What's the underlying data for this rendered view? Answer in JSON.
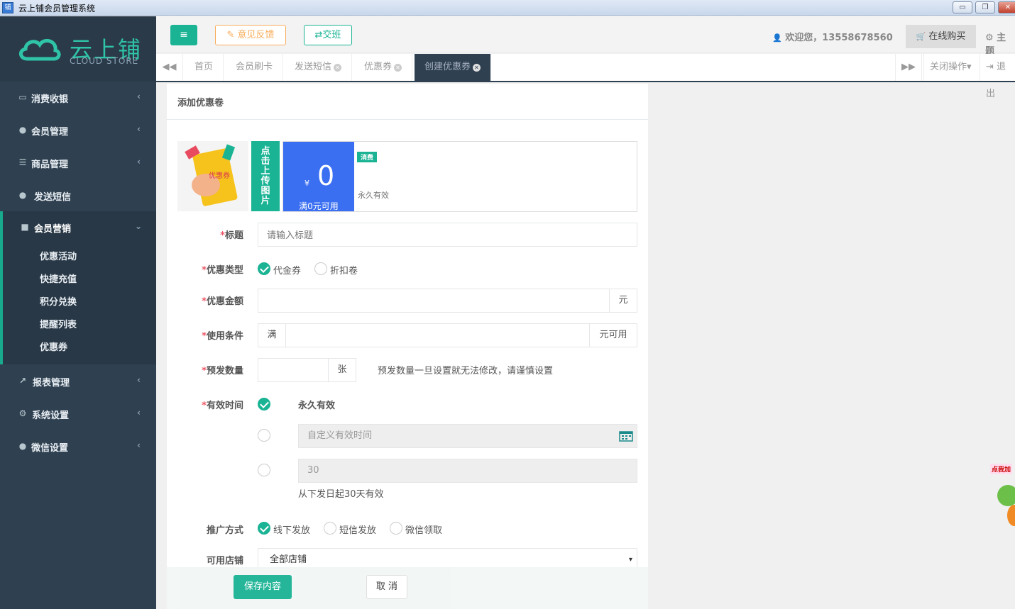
{
  "window": {
    "title": "云上铺会员管理系统",
    "icon_text": "铺",
    "minimize": "▭",
    "restore": "❐",
    "close": "✕"
  },
  "logo": {
    "brand": "云上铺",
    "brand_sub": "CLOUD STORE"
  },
  "sidebar": {
    "items": [
      {
        "label": "消费收银",
        "icon": "credit-card-icon",
        "glyph": "▭"
      },
      {
        "label": "会员管理",
        "icon": "user-icon",
        "glyph": "●"
      },
      {
        "label": "商品管理",
        "icon": "database-icon",
        "glyph": "☰"
      },
      {
        "label": "发送短信",
        "icon": "comment-icon",
        "glyph": "●"
      },
      {
        "label": "会员营销",
        "icon": "briefcase-icon",
        "glyph": "■"
      },
      {
        "label": "报表管理",
        "icon": "line-chart-icon",
        "glyph": "↗"
      },
      {
        "label": "系统设置",
        "icon": "cogs-icon",
        "glyph": "⚙"
      },
      {
        "label": "微信设置",
        "icon": "comments-icon",
        "glyph": "●"
      }
    ],
    "sub_items": [
      "优惠活动",
      "快捷充值",
      "积分兑换",
      "提醒列表",
      "优惠券"
    ],
    "chevron_collapsed": "‹",
    "chevron_expanded": "⌄"
  },
  "topbar": {
    "menu_glyph": "≡",
    "feedback": "✎ 意见反馈",
    "shift": "⇄交班",
    "welcome": "欢迎您，13558678560",
    "welcome_icon": "👤",
    "buy": "在线购买",
    "buy_icon": "🛒",
    "theme": "⚙ 主题"
  },
  "tabs": {
    "prev": "◀◀",
    "next": "▶▶",
    "items": [
      {
        "label": "首页",
        "closable": false
      },
      {
        "label": "会员刷卡",
        "closable": false
      },
      {
        "label": "发送短信",
        "closable": true
      },
      {
        "label": "优惠券",
        "closable": true
      },
      {
        "label": "创建优惠券",
        "closable": true,
        "active": true
      }
    ],
    "close_glyph": "✕",
    "close_ops": "关闭操作▾",
    "logout": "⇥ 退出"
  },
  "card": {
    "title": "添加优惠卷",
    "upload_btn": "点击上传图片",
    "coupon_img_label": "优惠券",
    "preview": {
      "currency": "¥",
      "amount": "0",
      "condition": "满0元可用",
      "tag": "消费",
      "validity": "永久有效"
    }
  },
  "form": {
    "required_mark": "*",
    "title_label": "标题",
    "title_placeholder": "请输入标题",
    "type_label": "优惠类型",
    "type_options": [
      "代金券",
      "折扣卷"
    ],
    "type_selected": "代金券",
    "amount_label": "优惠金额",
    "amount_unit": "元",
    "condition_label": "使用条件",
    "condition_prefix": "满",
    "condition_suffix": "元可用",
    "qty_label": "预发数量",
    "qty_unit": "张",
    "qty_hint": "预发数量一旦设置就无法修改，请谨慎设置",
    "valid_label": "有效时间",
    "valid_permanent": "永久有效",
    "valid_custom_placeholder": "自定义有效时间",
    "valid_days_value": "30",
    "valid_days_hint": "从下发日起30天有效",
    "promo_label": "推广方式",
    "promo_options": [
      "线下发放",
      "短信发放",
      "微信领取"
    ],
    "promo_selected": "线下发放",
    "store_label": "可用店铺",
    "store_value": "全部店铺",
    "store_arrow": "▾"
  },
  "footer": {
    "save": "保存内容",
    "cancel": "取 消"
  },
  "float_ad": {
    "text": "点我加"
  },
  "colors": {
    "sidebar_bg": "#2f4050",
    "accent": "#1ab394",
    "warning": "#f8ac59",
    "coupon_blue": "#3a6ff2"
  }
}
